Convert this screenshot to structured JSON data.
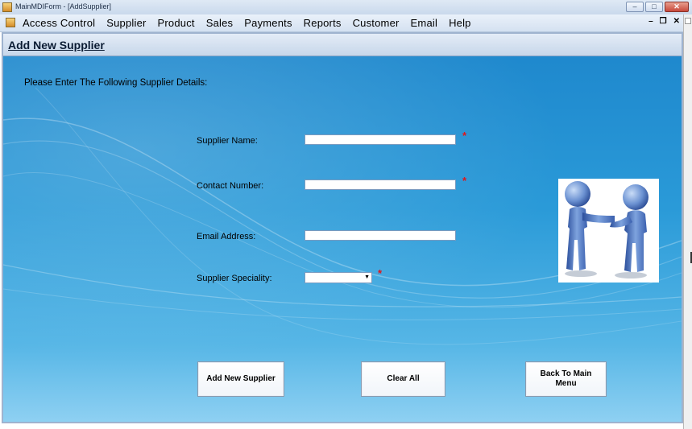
{
  "window": {
    "title": "MainMDIForm - [AddSupplier]"
  },
  "menu": {
    "items": [
      "Access Control",
      "Supplier",
      "Product",
      "Sales",
      "Payments",
      "Reports",
      "Customer",
      "Email",
      "Help"
    ]
  },
  "form": {
    "heading": "Add New Supplier",
    "instruction": "Please Enter The Following Supplier Details:",
    "fields": {
      "supplier_name_label": "Supplier Name:",
      "contact_number_label": "Contact Number:",
      "email_address_label": "Email Address:",
      "supplier_speciality_label": "Supplier Speciality:"
    },
    "required_marker": "*",
    "picture_icon": "handshake-people-icon"
  },
  "buttons": {
    "add": "Add New Supplier",
    "clear": "Clear All",
    "back": "Back To Main Menu"
  },
  "colors": {
    "background_blue": "#2a9ad8",
    "required_red": "#e0161a"
  }
}
